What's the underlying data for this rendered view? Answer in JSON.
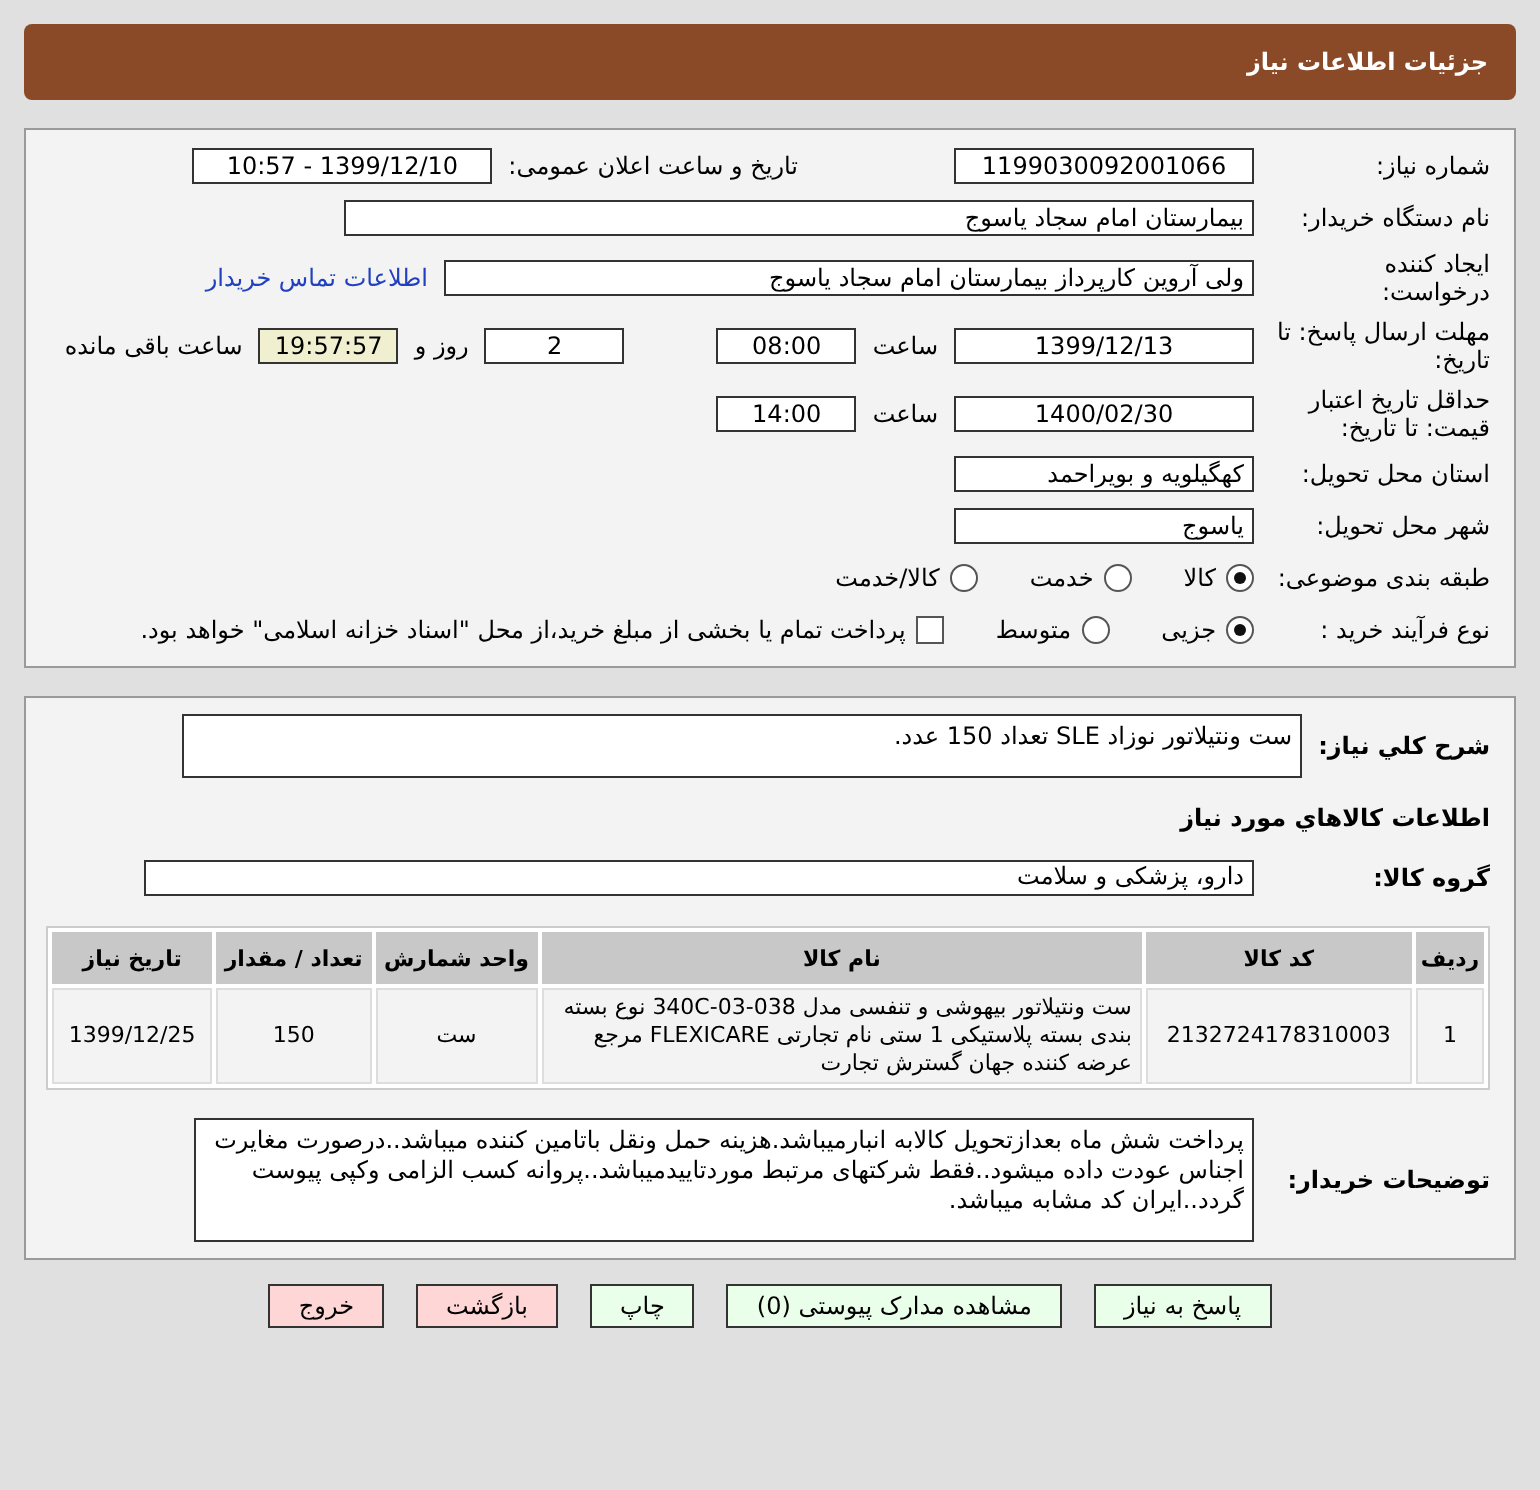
{
  "header": {
    "title": "جزئیات اطلاعات نیاز"
  },
  "need_number": {
    "label": "شماره نیاز:",
    "value": "1199030092001066"
  },
  "announce": {
    "label": "تاریخ و ساعت اعلان عمومی:",
    "value": "1399/12/10 - 10:57"
  },
  "buyer_org": {
    "label": "نام دستگاه خریدار:",
    "value": "بیمارستان امام سجاد یاسوج"
  },
  "creator": {
    "label": "ایجاد کننده درخواست:",
    "value": "ولی آروین کارپرداز بیمارستان امام سجاد یاسوج",
    "link": "اطلاعات تماس خریدار"
  },
  "deadline": {
    "label": "مهلت ارسال پاسخ: تا تاریخ:",
    "date": "1399/12/13",
    "time_label": "ساعت",
    "time": "08:00",
    "days": "2",
    "days_label": "روز و",
    "remaining": "19:57:57",
    "remaining_label": "ساعت باقی مانده"
  },
  "validity": {
    "label": "حداقل تاریخ اعتبار قیمت: تا تاریخ:",
    "date": "1400/02/30",
    "time_label": "ساعت",
    "time": "14:00"
  },
  "province": {
    "label": "استان محل تحویل:",
    "value": "کهگیلویه و بویراحمد"
  },
  "city": {
    "label": "شهر محل تحویل:",
    "value": "یاسوج"
  },
  "category": {
    "label": "طبقه بندی موضوعی:",
    "options": [
      {
        "label": "کالا",
        "selected": true
      },
      {
        "label": "خدمت",
        "selected": false
      },
      {
        "label": "کالا/خدمت",
        "selected": false
      }
    ]
  },
  "process": {
    "label": "نوع فرآیند خرید :",
    "options": [
      {
        "label": "جزیی",
        "selected": true
      },
      {
        "label": "متوسط",
        "selected": false
      }
    ],
    "treasury": {
      "checked": false,
      "label": "پرداخت تمام یا بخشی از مبلغ خرید،از محل \"اسناد خزانه اسلامی\" خواهد بود."
    }
  },
  "summary": {
    "label": "شرح کلي نياز:",
    "value": "ست ونتیلاتور نوزاد SLE تعداد 150 عدد."
  },
  "goods_heading": "اطلاعات کالاهاي مورد نياز",
  "goods_group": {
    "label": "گروه کالا:",
    "value": "دارو، پزشکی و سلامت"
  },
  "table": {
    "columns": [
      "ردیف",
      "کد کالا",
      "نام کالا",
      "واحد شمارش",
      "تعداد / مقدار",
      "تاریخ نیاز"
    ],
    "rows": [
      [
        "1",
        "2132724178310003",
        "ست ونتیلاتور بیهوشی و تنفسی مدل 038-03-340C نوع بسته بندی بسته پلاستیکی 1 ستی نام تجارتی FLEXICARE مرجع عرضه کننده جهان گسترش تجارت",
        "ست",
        "150",
        "1399/12/25"
      ]
    ]
  },
  "buyer_notes": {
    "label": "توضیحات خریدار:",
    "value": "پرداخت شش ماه بعدازتحویل کالابه انبارمیباشد.هزینه حمل ونقل باتامین کننده میباشد..درصورت مغایرت اجناس عودت داده میشود..فقط شرکتهای مرتبط موردتاییدمیباشد..پروانه کسب الزامی وکپی پیوست گردد..ایران کد مشابه میباشد."
  },
  "buttons": [
    {
      "label": "پاسخ به نیاز",
      "kind": "normal"
    },
    {
      "label": "مشاهده مدارک پیوستی (0)",
      "kind": "normal"
    },
    {
      "label": "چاپ",
      "kind": "normal"
    },
    {
      "label": "بازگشت",
      "kind": "exit"
    },
    {
      "label": "خروج",
      "kind": "exit"
    }
  ]
}
